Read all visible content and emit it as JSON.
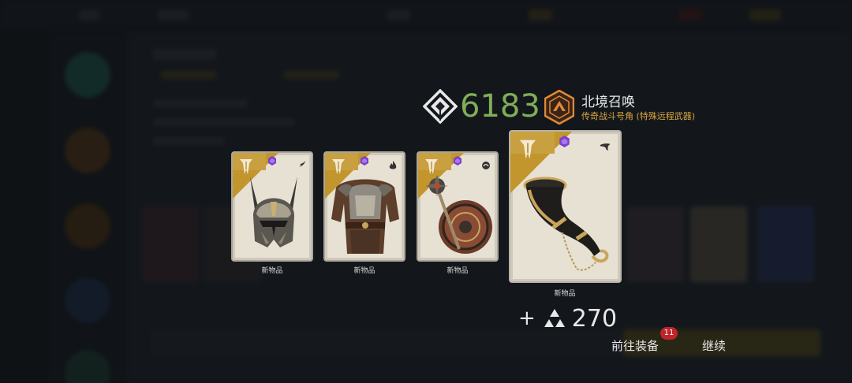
{
  "header": {
    "currency_icon": "diamond-gem-icon",
    "currency_value": "6183",
    "emblem_icon": "legendary-emblem-icon",
    "item_name": "北境召唤",
    "item_type": "传奇战斗号角 (特殊远程武器)"
  },
  "cards": [
    {
      "art": "helmet-art",
      "element_icon": "wind-icon",
      "caption": "新物品"
    },
    {
      "art": "chest-armor-art",
      "element_icon": "fire-icon",
      "caption": "新物品"
    },
    {
      "art": "mace-shield-art",
      "element_icon": "water-icon",
      "caption": "新物品"
    },
    {
      "art": "war-horn-art",
      "element_icon": "horn-icon",
      "caption": "新物品"
    }
  ],
  "reward": {
    "plus": "+",
    "icon": "triangle-shards-icon",
    "amount": "270"
  },
  "buttons": {
    "equip_label": "前往装备",
    "equip_badge": "11",
    "continue_label": "继续"
  },
  "colors": {
    "currency_green": "#7fae57",
    "item_type_gold": "#d9a640",
    "card_gold": "#c2962d",
    "gem_purple": "#7a3fd0",
    "badge_red": "#c0242a"
  }
}
